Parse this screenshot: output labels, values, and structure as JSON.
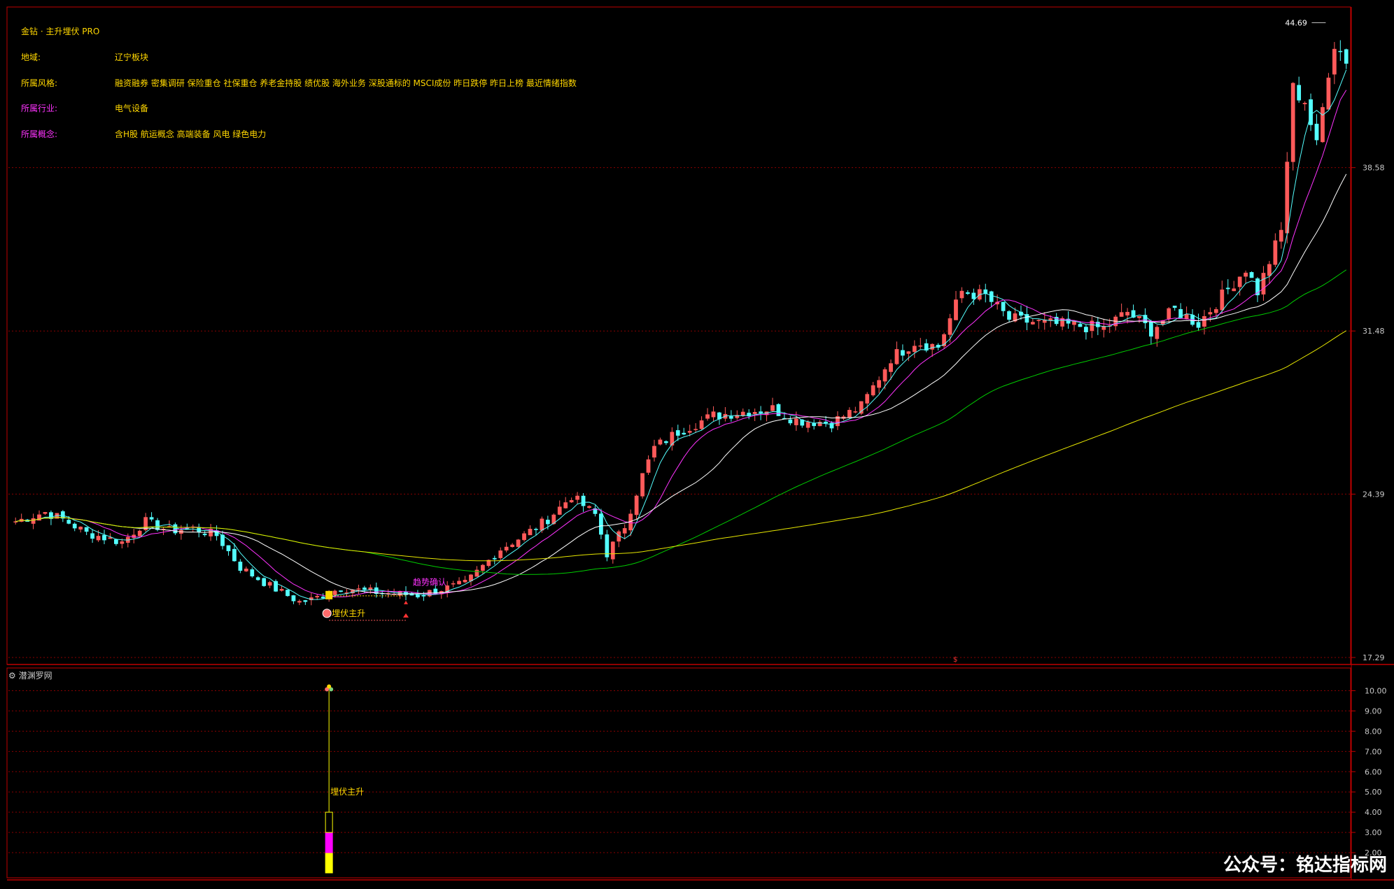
{
  "header": {
    "indicator_title": "金钻 · 主升埋伏 PRO",
    "rows": [
      {
        "label": "地域:",
        "value": "辽宁板块",
        "label_color": "#ffd700"
      },
      {
        "label": "所属风格:",
        "value": "融资融券 密集调研 保险重仓 社保重仓 养老金持股 绩优股 海外业务 深股通标的 MSCI成份 昨日跌停 昨日上榜 最近情绪指数",
        "label_color": "#ffd700"
      },
      {
        "label": "所属行业:",
        "value": "电气设备",
        "label_color": "#ff33ff"
      },
      {
        "label": "所属概念:",
        "value": "含H股 航运概念 高端装备 风电 绿色电力",
        "label_color": "#ff33ff"
      }
    ]
  },
  "colors": {
    "up": "#ff5a5a",
    "down": "#54ffff",
    "ma5": "#54ffff",
    "ma10": "#ff33ff",
    "ma20": "#ffffff",
    "ma60": "#00cc00",
    "ma120": "#e6e600",
    "grid": "#8b0000",
    "axis_text": "#c8c8c8",
    "frame": "#c00000"
  },
  "annotations": {
    "trend_confirm": "趋势确认",
    "ambush_main": "埋伏主升",
    "high_marker": "44.69",
    "sub_ambush": "埋伏主升"
  },
  "sub_panel": {
    "title": "潜渊罗网",
    "y_ticks": [
      "10.00",
      "9.00",
      "8.00",
      "7.00",
      "6.00",
      "5.00",
      "4.00",
      "3.00",
      "2.00"
    ]
  },
  "watermark": "公众号：铭达指标网",
  "chart_data": {
    "type": "candlestick",
    "y_ticks": [
      "38.58",
      "31.48",
      "24.39",
      "17.29"
    ],
    "ylim": [
      17.29,
      45.5
    ],
    "high_label": 44.69,
    "anchors": [
      [
        0,
        23.2
      ],
      [
        5,
        23.6
      ],
      [
        8,
        23.3
      ],
      [
        12,
        22.7
      ],
      [
        18,
        22.3
      ],
      [
        22,
        23.2
      ],
      [
        26,
        22.8
      ],
      [
        30,
        22.9
      ],
      [
        34,
        22.6
      ],
      [
        38,
        21.2
      ],
      [
        43,
        20.4
      ],
      [
        48,
        19.7
      ],
      [
        50,
        19.8
      ],
      [
        55,
        20.3
      ],
      [
        62,
        20.1
      ],
      [
        68,
        20.0
      ],
      [
        76,
        20.5
      ],
      [
        82,
        22.0
      ],
      [
        86,
        22.6
      ],
      [
        90,
        23.3
      ],
      [
        94,
        24.3
      ],
      [
        98,
        23.5
      ],
      [
        100,
        21.8
      ],
      [
        103,
        23.0
      ],
      [
        106,
        25.2
      ],
      [
        108,
        26.4
      ],
      [
        112,
        27.1
      ],
      [
        118,
        27.8
      ],
      [
        124,
        28.0
      ],
      [
        128,
        28.1
      ],
      [
        132,
        27.6
      ],
      [
        138,
        27.5
      ],
      [
        143,
        28.2
      ],
      [
        148,
        30.3
      ],
      [
        152,
        31.0
      ],
      [
        156,
        30.8
      ],
      [
        160,
        33.2
      ],
      [
        164,
        33.0
      ],
      [
        168,
        32.0
      ],
      [
        174,
        31.8
      ],
      [
        180,
        31.7
      ],
      [
        184,
        31.6
      ],
      [
        188,
        32.3
      ],
      [
        192,
        31.5
      ],
      [
        196,
        32.4
      ],
      [
        200,
        31.8
      ],
      [
        204,
        33.0
      ],
      [
        208,
        34.2
      ],
      [
        210,
        33.2
      ],
      [
        214,
        35.8
      ],
      [
        216,
        42.0
      ],
      [
        218,
        41.5
      ],
      [
        220,
        39.5
      ],
      [
        222,
        42.8
      ],
      [
        223,
        44.0
      ],
      [
        225,
        43.3
      ]
    ],
    "n_bars": 226,
    "moving_averages": [
      "MA5",
      "MA10",
      "MA20",
      "MA60",
      "MA120"
    ],
    "grid": true,
    "signals": [
      {
        "label": "埋伏主升",
        "bar": 53
      },
      {
        "label": "趋势确认",
        "bar": 66
      }
    ],
    "sub": {
      "ylim": [
        1.0,
        10.5
      ],
      "y_ticks": [
        10,
        9,
        8,
        7,
        6,
        5,
        4,
        3,
        2
      ],
      "signal_bar": 53,
      "stack": [
        {
          "from": 1.0,
          "to": 2.0,
          "color": "#ffff00"
        },
        {
          "from": 2.0,
          "to": 3.0,
          "color": "#ff00ff"
        },
        {
          "from": 3.0,
          "to": 4.0,
          "color": "#000000",
          "border": "#ffff00"
        }
      ],
      "line_to": 10.0
    }
  }
}
